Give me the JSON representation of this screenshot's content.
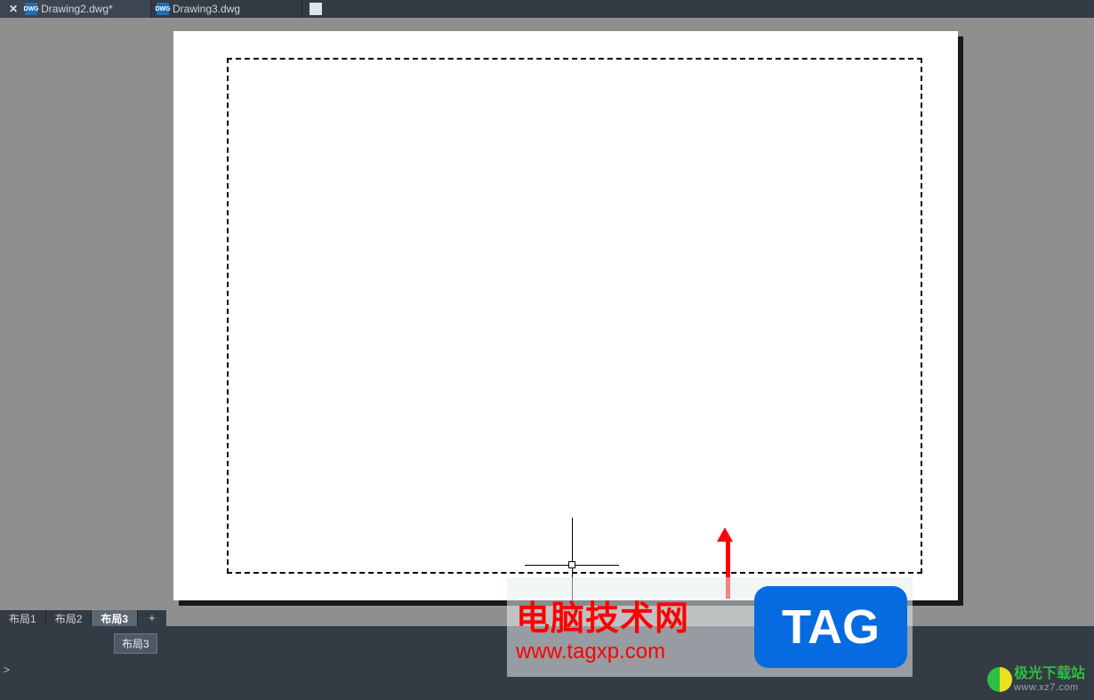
{
  "tabs": {
    "file1": "Drawing2.dwg*",
    "file2": "Drawing3.dwg",
    "dwg_icon_text": "DWG"
  },
  "layout_tabs": {
    "t1": "布局1",
    "t2": "布局2",
    "t3": "布局3",
    "add": "+"
  },
  "tooltip": "布局3",
  "cmd_prompt": ">",
  "watermark": {
    "title": "电脑技术网",
    "url": "www.tagxp.com",
    "tag": "TAG"
  },
  "site": {
    "name": "极光下载站",
    "url": "www.xz7.com"
  }
}
